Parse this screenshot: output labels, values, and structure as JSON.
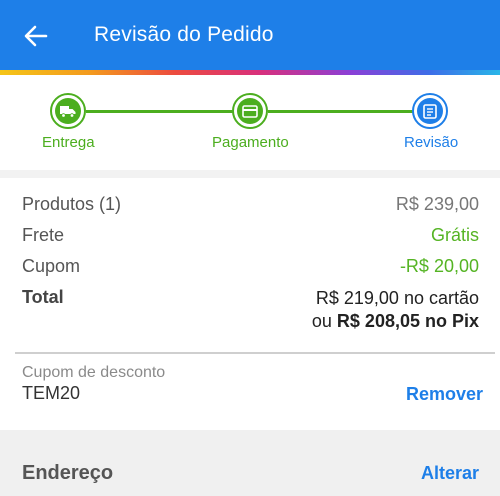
{
  "app_bar": {
    "title": "Revisão do Pedido",
    "back_icon": "arrow-left-icon",
    "color": "#1e7fe8"
  },
  "stepper": {
    "steps": [
      {
        "label": "Entrega",
        "icon": "truck-icon",
        "state": "done"
      },
      {
        "label": "Pagamento",
        "icon": "credit-card-icon",
        "state": "done"
      },
      {
        "label": "Revisão",
        "icon": "receipt-icon",
        "state": "active"
      }
    ],
    "done_color": "#4cae1f",
    "active_color": "#1e7fe8"
  },
  "summary": {
    "products_label": "Produtos (1)",
    "products_value": "R$ 239,00",
    "shipping_label": "Frete",
    "shipping_value": "Grátis",
    "coupon_label": "Cupom",
    "coupon_value": "-R$ 20,00",
    "total_label": "Total",
    "total_card": "R$ 219,00 no cartão",
    "total_pix_prefix": "ou",
    "total_pix_value": "R$ 208,05 no Pix"
  },
  "coupon": {
    "label": "Cupom de desconto",
    "code": "TEM20",
    "remove_label": "Remover"
  },
  "address": {
    "title": "Endereço",
    "change_label": "Alterar"
  }
}
